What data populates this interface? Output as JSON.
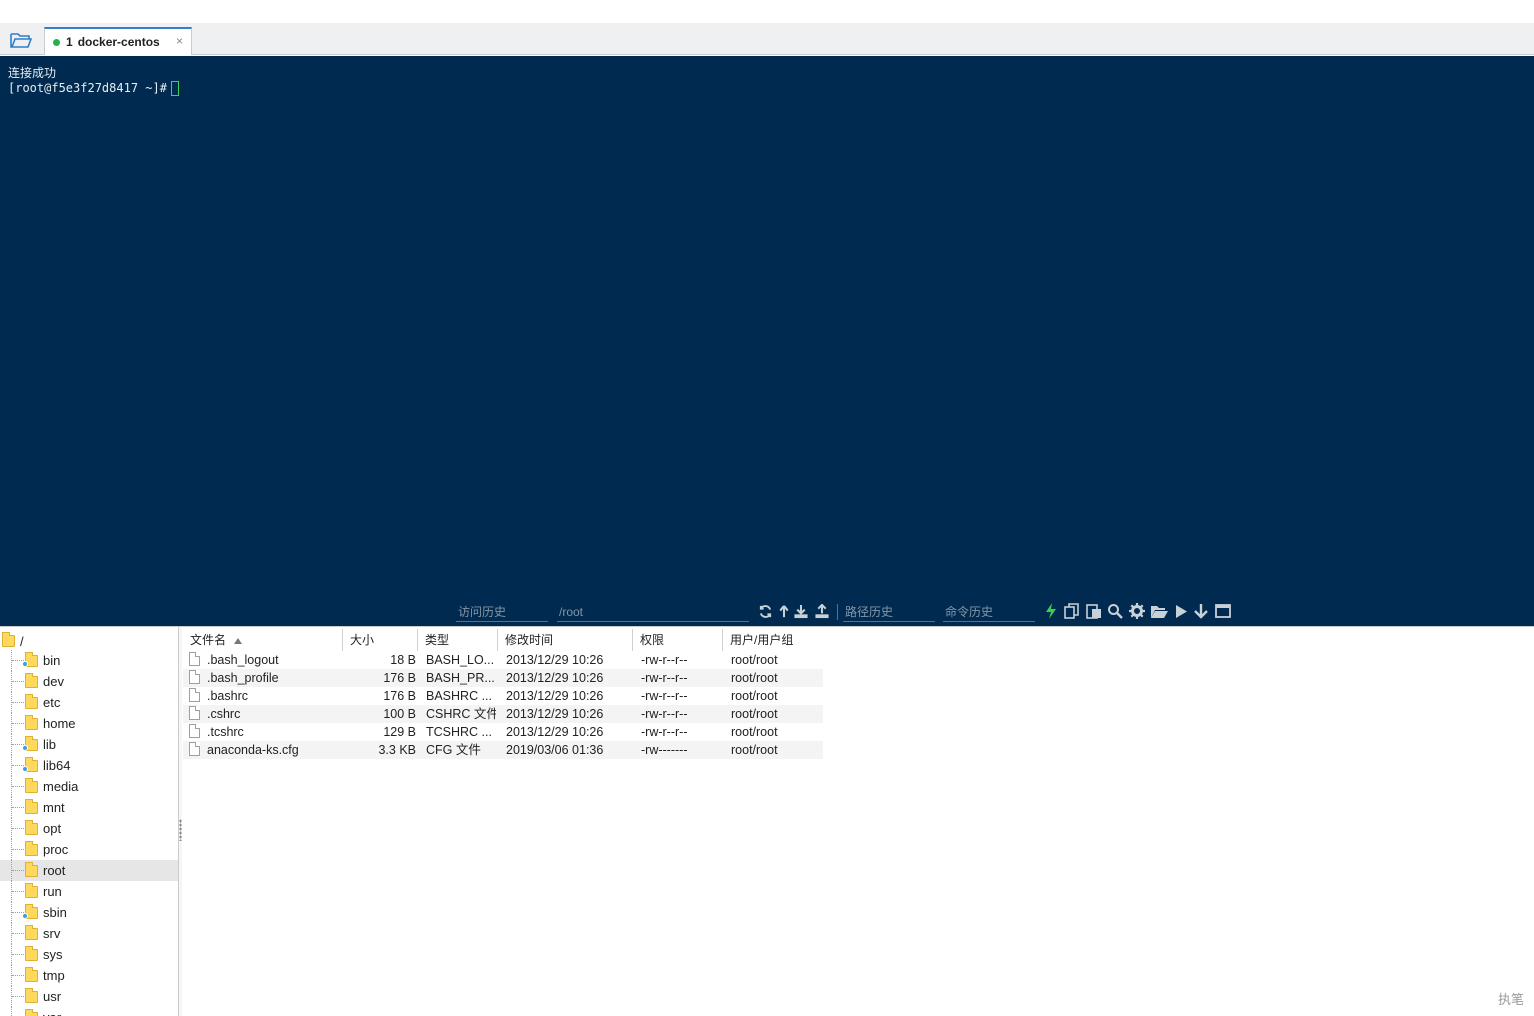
{
  "tab": {
    "number": "1",
    "title": "docker-centos",
    "close": "×"
  },
  "terminal": {
    "line1": "连接成功",
    "prompt": "[root@f5e3f27d8417 ~]#"
  },
  "toolbar": {
    "visit_history": "访问历史",
    "path": "/root",
    "path_history": "路径历史",
    "command_history": "命令历史",
    "icons": [
      "refresh-icon",
      "up-dir-icon",
      "download-icon",
      "upload-icon",
      "lightning-icon",
      "copy-icon",
      "paste-icon",
      "search-icon",
      "gear-icon",
      "folder-open-icon",
      "play-icon",
      "arrow-down-icon",
      "window-icon"
    ]
  },
  "tree": {
    "root": "/",
    "items": [
      {
        "label": "bin",
        "link": true
      },
      {
        "label": "dev",
        "link": false
      },
      {
        "label": "etc",
        "link": false
      },
      {
        "label": "home",
        "link": false
      },
      {
        "label": "lib",
        "link": true
      },
      {
        "label": "lib64",
        "link": true
      },
      {
        "label": "media",
        "link": false
      },
      {
        "label": "mnt",
        "link": false
      },
      {
        "label": "opt",
        "link": false
      },
      {
        "label": "proc",
        "link": false
      },
      {
        "label": "root",
        "link": false,
        "selected": true
      },
      {
        "label": "run",
        "link": false
      },
      {
        "label": "sbin",
        "link": true
      },
      {
        "label": "srv",
        "link": false
      },
      {
        "label": "sys",
        "link": false
      },
      {
        "label": "tmp",
        "link": false
      },
      {
        "label": "usr",
        "link": false
      },
      {
        "label": "var",
        "link": false
      }
    ]
  },
  "files": {
    "headers": {
      "name": "文件名",
      "size": "大小",
      "type": "类型",
      "modified": "修改时间",
      "perm": "权限",
      "owner": "用户/用户组"
    },
    "rows": [
      {
        "name": ".bash_logout",
        "size": "18 B",
        "type": "BASH_LO...",
        "modified": "2013/12/29 10:26",
        "perm": "-rw-r--r--",
        "owner": "root/root"
      },
      {
        "name": ".bash_profile",
        "size": "176 B",
        "type": "BASH_PR...",
        "modified": "2013/12/29 10:26",
        "perm": "-rw-r--r--",
        "owner": "root/root"
      },
      {
        "name": ".bashrc",
        "size": "176 B",
        "type": "BASHRC ...",
        "modified": "2013/12/29 10:26",
        "perm": "-rw-r--r--",
        "owner": "root/root"
      },
      {
        "name": ".cshrc",
        "size": "100 B",
        "type": "CSHRC 文件",
        "modified": "2013/12/29 10:26",
        "perm": "-rw-r--r--",
        "owner": "root/root"
      },
      {
        "name": ".tcshrc",
        "size": "129 B",
        "type": "TCSHRC ...",
        "modified": "2013/12/29 10:26",
        "perm": "-rw-r--r--",
        "owner": "root/root"
      },
      {
        "name": "anaconda-ks.cfg",
        "size": "3.3 KB",
        "type": "CFG 文件",
        "modified": "2019/03/06 01:36",
        "perm": "-rw-------",
        "owner": "root/root"
      }
    ]
  },
  "watermark": "执笔"
}
